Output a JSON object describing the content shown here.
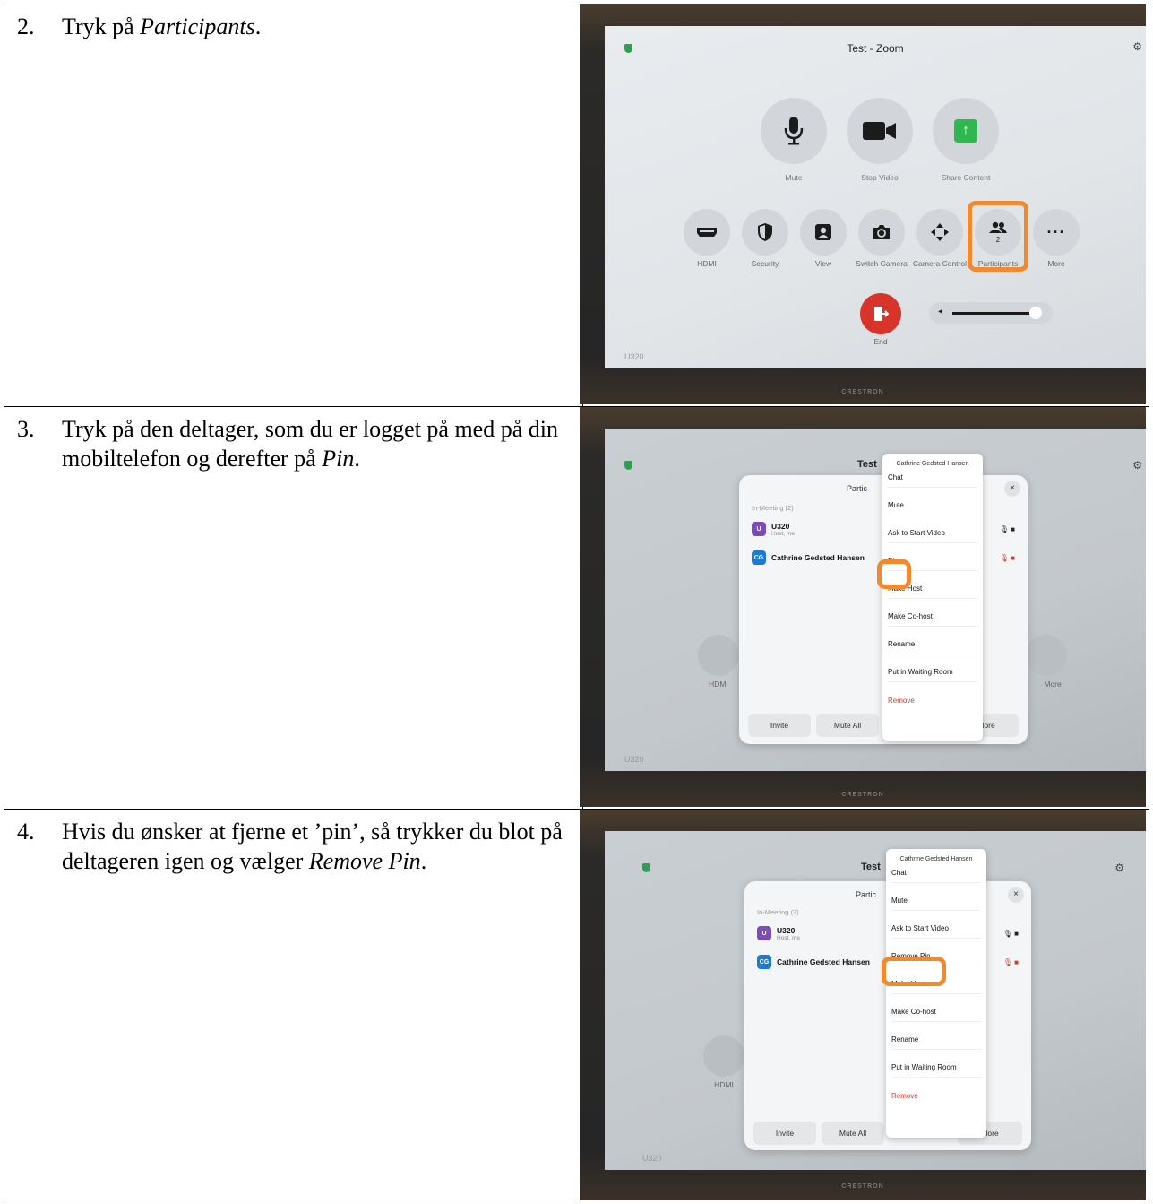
{
  "steps": [
    {
      "number": "2.",
      "text_before": "Tryk på ",
      "text_italic": "Participants",
      "text_after": "."
    },
    {
      "number": "3.",
      "text_before": "Tryk på den deltager, som du er logget på med på din mobiltelefon og derefter på ",
      "text_italic": "Pin",
      "text_after": "."
    },
    {
      "number": "4.",
      "text_before": "Hvis du ønsker at fjerne et ’pin’, så trykker du blot på deltageren igen og vælger ",
      "text_italic": "Remove Pin",
      "text_after": "."
    }
  ],
  "panel1": {
    "title": "Test - Zoom",
    "main_buttons": [
      {
        "icon": "microphone-icon",
        "label": "Mute"
      },
      {
        "icon": "video-camera-icon",
        "label": "Stop Video"
      },
      {
        "icon": "share-arrow-icon",
        "label": "Share Content",
        "color": "#2eb84f"
      }
    ],
    "small_buttons": [
      {
        "icon": "hdmi-icon",
        "label": "HDMI"
      },
      {
        "icon": "shield-icon",
        "label": "Security"
      },
      {
        "icon": "person-icon",
        "label": "View"
      },
      {
        "icon": "camera-switch-icon",
        "label": "Switch Camera"
      },
      {
        "icon": "move-arrows-icon",
        "label": "Camera Control"
      },
      {
        "icon": "people-icon",
        "label": "Participants",
        "badge": "2"
      },
      {
        "icon": "more-dots-icon",
        "label": "More"
      }
    ],
    "end_label": "End",
    "end_color": "#d9342b",
    "room": "U320",
    "brand": "CRESTRON",
    "highlight_color": "#f08a30"
  },
  "panel2": {
    "title_partial": "Test",
    "dialog_title_partial": "Partic",
    "section": "In-Meeting (2)",
    "participants": [
      {
        "avatar": "U",
        "name": "U320",
        "sub": "Host, me",
        "color": "#7b4bb8"
      },
      {
        "avatar": "CG",
        "name": "Cathrine Gedsted Hansen",
        "sub": "",
        "color": "#1f7ad1"
      }
    ],
    "menu_header": "Cathrine Gedsted Hansen",
    "menu_items": [
      "Chat",
      "Mute",
      "Ask to Start Video",
      "Pin",
      "Make Host",
      "Make Co-host",
      "Rename",
      "Put in Waiting Room",
      "Remove"
    ],
    "bottom_buttons": [
      "Invite",
      "Mute All",
      "More"
    ],
    "bg_hdmi": "HDMI",
    "bg_more": "More",
    "room": "U320",
    "brand": "CRESTRON"
  },
  "panel3": {
    "title_partial": "Test",
    "dialog_title_partial": "Partic",
    "section": "In-Meeting (2)",
    "participants": [
      {
        "avatar": "U",
        "name": "U320",
        "sub": "Host, me",
        "color": "#7b4bb8"
      },
      {
        "avatar": "CG",
        "name": "Cathrine Gedsted Hansen",
        "sub": "",
        "color": "#1f7ad1"
      }
    ],
    "menu_header": "Cathrine Gedsted Hansen",
    "menu_items": [
      "Chat",
      "Mute",
      "Ask to Start Video",
      "Remove Pin",
      "Make Host",
      "Make Co-host",
      "Rename",
      "Put in Waiting Room",
      "Remove"
    ],
    "bottom_buttons": [
      "Invite",
      "Mute All",
      "More"
    ],
    "bg_hdmi": "HDMI",
    "room": "U320",
    "brand": "CRESTRON"
  }
}
